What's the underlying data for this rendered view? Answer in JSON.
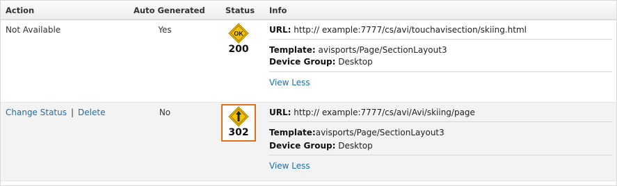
{
  "columns": {
    "action": "Action",
    "auto_generated": "Auto Generated",
    "status": "Status",
    "info": "Info"
  },
  "rows": [
    {
      "action": "Not Available",
      "auto_generated": "Yes",
      "status_code": "200",
      "status_icon": "ok-sign-icon",
      "status_icon_text": "OK",
      "url_label": "URL:",
      "url_value": "http:// example:7777/cs/avi/touchavisection/skiing.html",
      "template_label": "Template:",
      "template_value": "avisports/Page/SectionLayout3",
      "device_group_label": "Device Group:",
      "device_group_value": "Desktop",
      "view_less": "View Less"
    },
    {
      "action_change_status": "Change Status",
      "action_separator": "|",
      "action_delete": "Delete",
      "auto_generated": "No",
      "status_code": "302",
      "status_icon": "redirect-sign-icon",
      "url_label": "URL:",
      "url_value": "http:// example:7777/cs/avi/Avi/skiing/page",
      "template_label": "Template:",
      "template_value": "avisports/Page/SectionLayout3",
      "device_group_label": "Device Group:",
      "device_group_value": "Desktop",
      "view_less": "View Less"
    }
  ],
  "colors": {
    "link": "#1a6ea8",
    "sign_fill": "#f5c400",
    "selected_border": "#e0701a"
  }
}
